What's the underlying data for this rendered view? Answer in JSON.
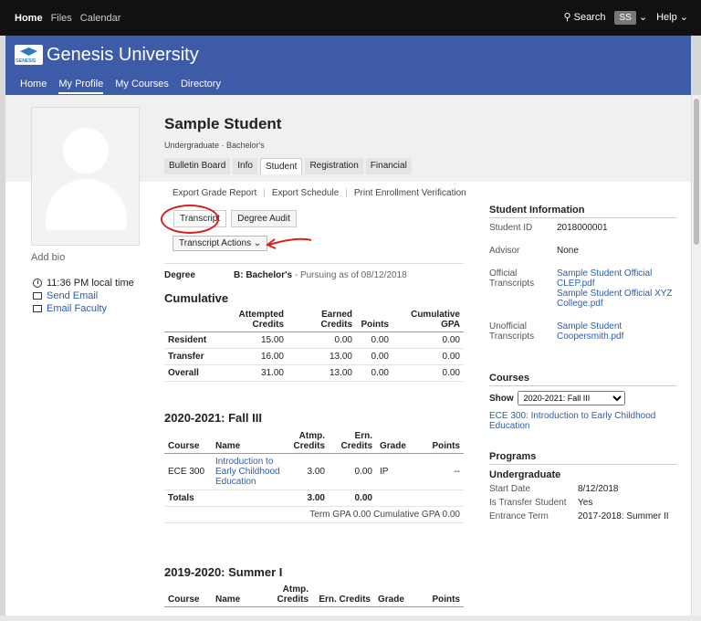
{
  "topbar": {
    "links": [
      "Home",
      "Files",
      "Calendar"
    ],
    "search": "Search",
    "avatar": "SS",
    "help": "Help"
  },
  "header": {
    "title": "Genesis University",
    "logo_text": "GENESIS",
    "nav": [
      "Home",
      "My Profile",
      "My Courses",
      "Directory"
    ],
    "active_nav": "My Profile"
  },
  "profile": {
    "name": "Sample Student",
    "subtitle": "Undergraduate · Bachelor's",
    "tabs": [
      "Bulletin Board",
      "Info",
      "Student",
      "Registration",
      "Financial"
    ],
    "active_tab": "Student",
    "add_bio": "Add bio",
    "local_time": "11:36 PM local time",
    "send_email": "Send Email",
    "email_faculty": "Email Faculty"
  },
  "actions": [
    "Export Grade Report",
    "Export Schedule",
    "Print Enrollment Verification"
  ],
  "subtabs": [
    "Transcript",
    "Degree Audit"
  ],
  "active_subtab": "Transcript",
  "transcript_actions": "Transcript Actions",
  "degree": {
    "label": "Degree",
    "value": "B: Bachelor's",
    "status": "- Pursuing as of 08/12/2018"
  },
  "cumulative": {
    "title": "Cumulative",
    "headers": [
      "",
      "Attempted Credits",
      "Earned Credits",
      "Points",
      "Cumulative GPA"
    ],
    "rows": [
      [
        "Resident",
        "15.00",
        "0.00",
        "0.00",
        "0.00"
      ],
      [
        "Transfer",
        "16.00",
        "13.00",
        "0.00",
        "0.00"
      ],
      [
        "Overall",
        "31.00",
        "13.00",
        "0.00",
        "0.00"
      ]
    ]
  },
  "term1": {
    "title": "2020-2021: Fall III",
    "headers": [
      "Course",
      "Name",
      "Atmp. Credits",
      "Ern. Credits",
      "Grade",
      "Points"
    ],
    "rows": [
      [
        "ECE 300",
        "Introduction to Early Childhood Education",
        "3.00",
        "0.00",
        "IP",
        "--"
      ]
    ],
    "totals": [
      "Totals",
      "3.00",
      "0.00"
    ],
    "gpa": "Term GPA 0.00   Cumulative GPA 0.00"
  },
  "term2": {
    "title": "2019-2020: Summer I",
    "headers": [
      "Course",
      "Name",
      "Atmp. Credits",
      "Ern. Credits",
      "Grade",
      "Points"
    ]
  },
  "student_info": {
    "title": "Student Information",
    "student_id_label": "Student ID",
    "student_id": "2018000001",
    "advisor_label": "Advisor",
    "advisor": "None",
    "official_label": "Official Transcripts",
    "official": [
      "Sample Student Official CLEP.pdf",
      "Sample Student Official XYZ College.pdf"
    ],
    "unofficial_label": "Unofficial Transcripts",
    "unofficial": [
      "Sample Student Coopersmith.pdf"
    ]
  },
  "courses": {
    "title": "Courses",
    "show_label": "Show",
    "selected": "2020-2021: Fall III",
    "items": [
      "ECE 300: Introduction to Early Childhood Education"
    ]
  },
  "programs": {
    "title": "Programs",
    "level": "Undergraduate",
    "start_label": "Start Date",
    "start": "8/12/2018",
    "transfer_label": "Is Transfer Student",
    "transfer": "Yes",
    "entrance_label": "Entrance Term",
    "entrance": "2017-2018: Summer II"
  },
  "colors": {
    "brand": "#3e5ba8",
    "annotation": "#d92020",
    "link": "#2a5db0"
  }
}
